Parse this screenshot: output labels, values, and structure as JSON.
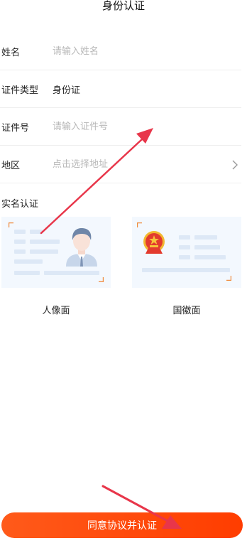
{
  "page": {
    "title": "身份认证"
  },
  "form": {
    "name": {
      "label": "姓名",
      "placeholder": "请输入姓名"
    },
    "id_type": {
      "label": "证件类型",
      "value": "身份证"
    },
    "id_number": {
      "label": "证件号",
      "placeholder": "请输入证件号"
    },
    "region": {
      "label": "地区",
      "placeholder": "点击选择地址"
    }
  },
  "real_name": {
    "label": "实名认证",
    "front_label": "人像面",
    "back_label": "国徽面"
  },
  "submit": {
    "label": "同意协议并认证"
  },
  "colors": {
    "accent": "#ff4a0d",
    "annotation": "#e8364a",
    "card_bg": "#f3f8fe"
  }
}
